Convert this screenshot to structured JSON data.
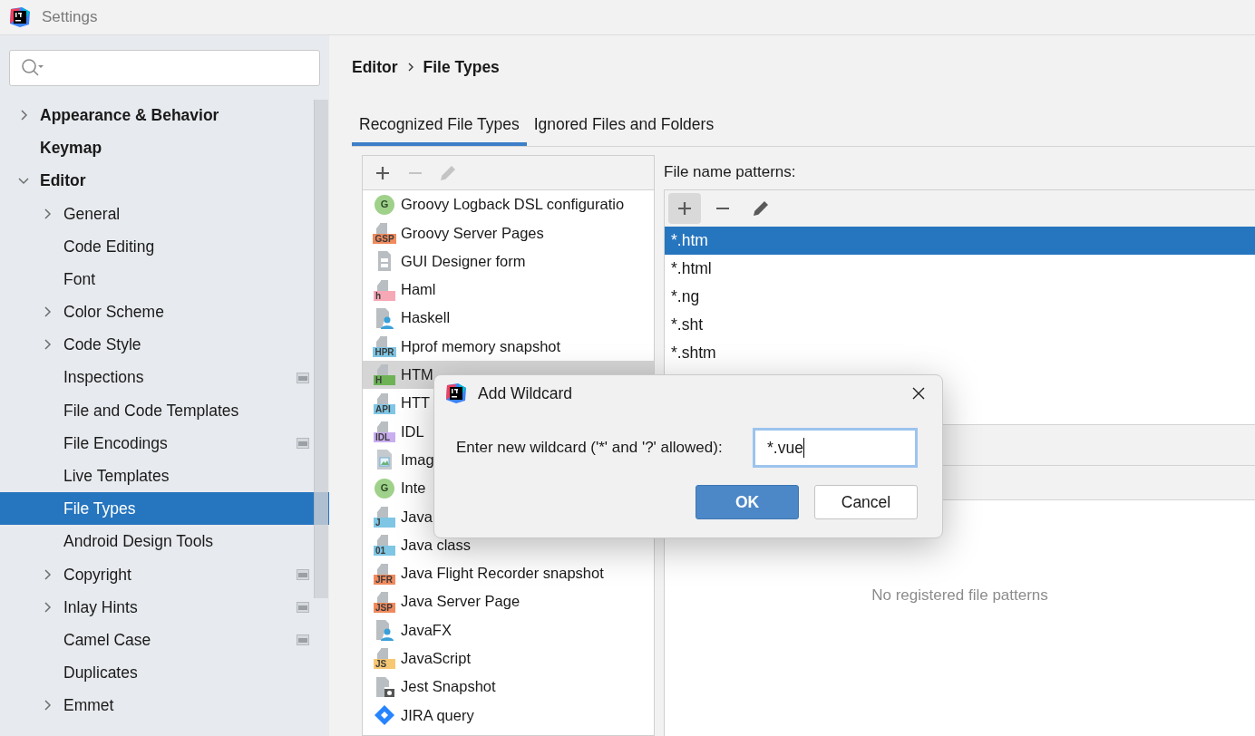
{
  "window": {
    "title": "Settings"
  },
  "sidebar": {
    "items": [
      {
        "label": "Appearance & Behavior",
        "bold": true,
        "expanded": false,
        "selected": false
      },
      {
        "label": "Keymap",
        "bold": true,
        "selected": false
      },
      {
        "label": "Editor",
        "bold": true,
        "expanded": true,
        "selected": false,
        "children": [
          {
            "label": "General",
            "expanded": false,
            "selected": false
          },
          {
            "label": "Code Editing",
            "selected": false
          },
          {
            "label": "Font",
            "selected": false
          },
          {
            "label": "Color Scheme",
            "expanded": false,
            "selected": false
          },
          {
            "label": "Code Style",
            "expanded": false,
            "selected": false
          },
          {
            "label": "Inspections",
            "project": true,
            "selected": false
          },
          {
            "label": "File and Code Templates",
            "selected": false
          },
          {
            "label": "File Encodings",
            "project": true,
            "selected": false
          },
          {
            "label": "Live Templates",
            "selected": false
          },
          {
            "label": "File Types",
            "selected": true
          },
          {
            "label": "Android Design Tools",
            "selected": false
          },
          {
            "label": "Copyright",
            "expanded": false,
            "project": true,
            "selected": false
          },
          {
            "label": "Inlay Hints",
            "expanded": false,
            "project": true,
            "selected": false
          },
          {
            "label": "Camel Case",
            "project": true,
            "selected": false
          },
          {
            "label": "Duplicates",
            "selected": false
          },
          {
            "label": "Emmet",
            "expanded": false,
            "selected": false
          }
        ]
      }
    ]
  },
  "breadcrumb": [
    "Editor",
    "File Types"
  ],
  "tabs": [
    {
      "label": "Recognized File Types",
      "selected": true
    },
    {
      "label": "Ignored Files and Folders",
      "selected": false
    }
  ],
  "file_types": {
    "toolbar": [
      {
        "kind": "add",
        "disabled": false
      },
      {
        "kind": "remove",
        "disabled": true
      },
      {
        "kind": "edit",
        "disabled": true
      }
    ],
    "items": [
      {
        "label": "Groovy Logback DSL configuratio",
        "kind": "circle",
        "badge": "G",
        "color": "#9fd18a",
        "selected": false
      },
      {
        "label": "Groovy Server Pages",
        "kind": "badge",
        "badge": "GSP",
        "color": "#f08a5d",
        "selected": false
      },
      {
        "label": "GUI Designer form",
        "kind": "form",
        "selected": false
      },
      {
        "label": "Haml",
        "kind": "badge",
        "badge": "h",
        "color": "#f7a8b6",
        "selected": false
      },
      {
        "label": "Haskell",
        "kind": "person",
        "selected": false
      },
      {
        "label": "Hprof memory snapshot",
        "kind": "badge",
        "badge": "HPR",
        "color": "#7fc6e4",
        "selected": false
      },
      {
        "label": "HTM",
        "kind": "badge",
        "badge": "H",
        "color": "#6db356",
        "selected": true
      },
      {
        "label": "HTT",
        "kind": "badge",
        "badge": "API",
        "color": "#7fc6e4",
        "selected": false
      },
      {
        "label": "IDL",
        "kind": "badge",
        "badge": "IDL",
        "color": "#c9aef0",
        "selected": false
      },
      {
        "label": "Imag",
        "kind": "image",
        "selected": false
      },
      {
        "label": "Inte",
        "kind": "circle",
        "badge": "G",
        "color": "#9fd18a",
        "selected": false
      },
      {
        "label": "Java",
        "kind": "badge",
        "badge": "J",
        "color": "#7fc6e4",
        "selected": false
      },
      {
        "label": "Java class",
        "kind": "badge",
        "badge": "01",
        "color": "#7fc6e4",
        "selected": false
      },
      {
        "label": "Java Flight Recorder snapshot",
        "kind": "badge",
        "badge": "JFR",
        "color": "#f08a5d",
        "selected": false
      },
      {
        "label": "Java Server Page",
        "kind": "badge",
        "badge": "JSP",
        "color": "#f08a5d",
        "selected": false
      },
      {
        "label": "JavaFX",
        "kind": "person",
        "selected": false
      },
      {
        "label": "JavaScript",
        "kind": "badge",
        "badge": "JS",
        "color": "#f7c873",
        "selected": false
      },
      {
        "label": "Jest Snapshot",
        "kind": "camera",
        "selected": false
      },
      {
        "label": "JIRA query",
        "kind": "diamond",
        "selected": false
      }
    ]
  },
  "patterns": {
    "label": "File name patterns:",
    "toolbar": [
      {
        "kind": "add",
        "disabled": false
      },
      {
        "kind": "remove",
        "disabled": false
      },
      {
        "kind": "edit",
        "disabled": false
      }
    ],
    "items": [
      {
        "label": "*.htm",
        "selected": true
      },
      {
        "label": "*.html",
        "selected": false
      },
      {
        "label": "*.ng",
        "selected": false
      },
      {
        "label": "*.sht",
        "selected": false
      },
      {
        "label": "*.shtm",
        "selected": false
      }
    ],
    "empty_text": "No registered file patterns"
  },
  "dialog": {
    "title": "Add Wildcard",
    "label": "Enter new wildcard ('*' and '?' allowed):",
    "value": "*.vue",
    "buttons": [
      {
        "label": "OK",
        "default": true
      },
      {
        "label": "Cancel",
        "default": false
      }
    ]
  }
}
